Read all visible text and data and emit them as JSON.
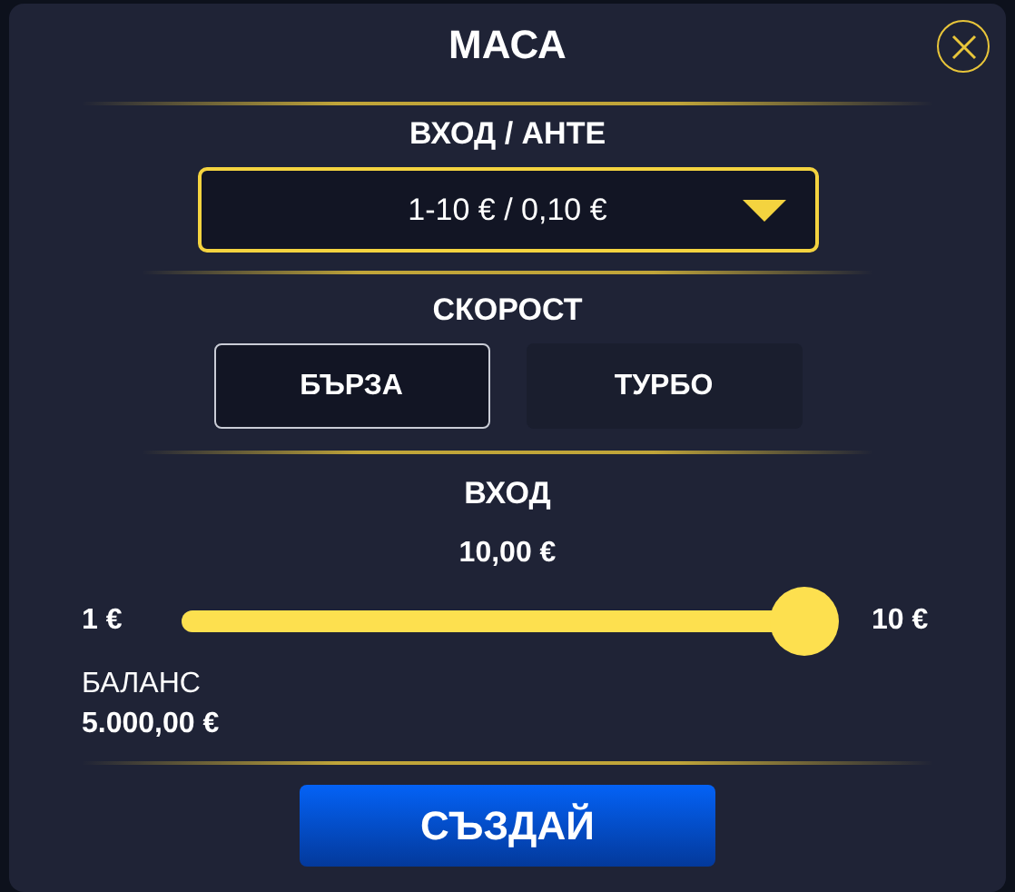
{
  "dialog": {
    "title": "МАСА"
  },
  "stake": {
    "label": "ВХОД / АНТЕ",
    "value": "1-10 € / 0,10 €"
  },
  "speed": {
    "label": "СКОРОСТ",
    "options": [
      {
        "label": "БЪРЗА",
        "selected": true
      },
      {
        "label": "ТУРБО",
        "selected": false
      }
    ]
  },
  "buy_in": {
    "label": "ВХОД",
    "reading": "10,00 €",
    "min": "1 €",
    "max": "10 €",
    "level": 1
  },
  "balance": {
    "label": "БАЛАНС",
    "value": "5.000,00 €"
  },
  "create_button": {
    "label": "СЪЗДАЙ"
  }
}
